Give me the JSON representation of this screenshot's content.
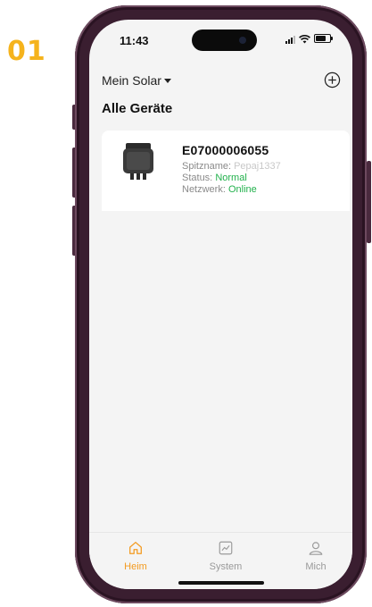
{
  "step_number": "01",
  "statusbar": {
    "time": "11:43"
  },
  "header": {
    "site_selector": "Mein Solar",
    "add_icon": "plus-circle-icon"
  },
  "section": {
    "title": "Alle Geräte"
  },
  "device": {
    "id": "E07000006055",
    "nickname_label": "Spitzname:",
    "nickname_value": "Pepaj1337",
    "status_label": "Status:",
    "status_value": "Normal",
    "network_label": "Netzwerk:",
    "network_value": "Online",
    "status_color": "#22b14c"
  },
  "tabs": [
    {
      "label": "Heim",
      "icon": "home-icon",
      "active": true
    },
    {
      "label": "System",
      "icon": "chart-icon",
      "active": false
    },
    {
      "label": "Mich",
      "icon": "user-icon",
      "active": false
    }
  ],
  "colors": {
    "accent": "#f39a1f",
    "step_number": "#f5b31c",
    "phone_frame": "#3a1e30"
  }
}
